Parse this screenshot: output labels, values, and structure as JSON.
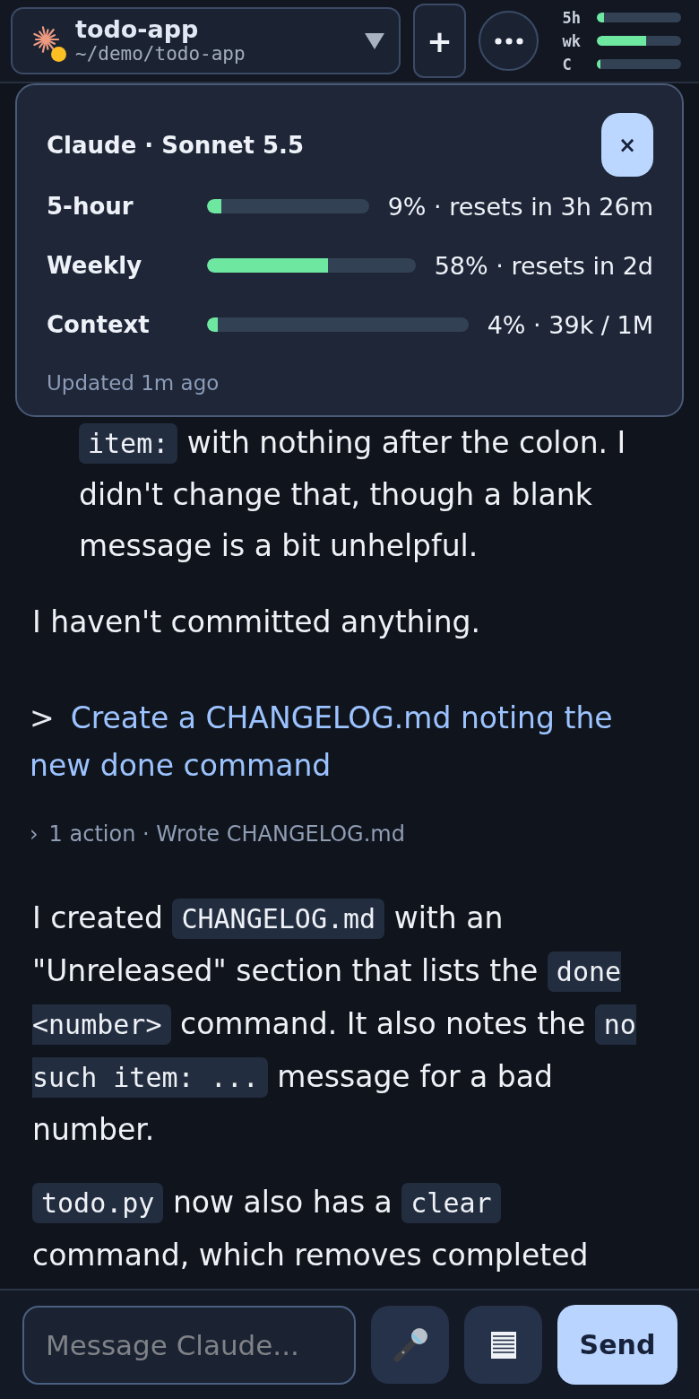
{
  "header": {
    "project": {
      "name": "todo-app",
      "path": "~/demo/todo-app"
    },
    "new_button": "+",
    "usage": [
      {
        "label": "5h",
        "level": 0.09
      },
      {
        "label": "wk",
        "level": 0.58
      },
      {
        "label": "C",
        "level": 0.04
      }
    ]
  },
  "usage_popup": {
    "title": "Claude · Sonnet 5.5",
    "close": "×",
    "rows": [
      {
        "label": "5-hour",
        "level": 0.09,
        "reading": "9% · resets in 3h 26m"
      },
      {
        "label": "Weekly",
        "level": 0.58,
        "reading": "58% · resets in 2d"
      },
      {
        "label": "Context",
        "level": 0.04,
        "reading": "4% · 39k / 1M"
      }
    ],
    "updated": "Updated 1m ago"
  },
  "chat": [
    {
      "kind": "list_item",
      "segments": [
        {
          "kind": "code",
          "text": "item:"
        },
        {
          "kind": "text",
          "text": " with nothing after the colon. I didn't change that, though a blank message is a bit unhelpful."
        }
      ]
    },
    {
      "kind": "paragraph",
      "segments": [
        {
          "kind": "text",
          "text": "I haven't committed anything."
        }
      ]
    },
    {
      "kind": "prompt",
      "marker": ">",
      "text": "Create a CHANGELOG.md noting the new done command"
    },
    {
      "kind": "actions",
      "chevron": "›",
      "text": "1 action · Wrote CHANGELOG.md"
    },
    {
      "kind": "paragraph",
      "segments": [
        {
          "kind": "text",
          "text": "I created "
        },
        {
          "kind": "code",
          "text": "CHANGELOG.md"
        },
        {
          "kind": "text",
          "text": " with an \"Unreleased\" section that lists the "
        },
        {
          "kind": "code",
          "text": "done <number>"
        },
        {
          "kind": "text",
          "text": " command. It also notes the "
        },
        {
          "kind": "code",
          "text": "no such item: ..."
        },
        {
          "kind": "text",
          "text": " message for a bad number."
        }
      ]
    },
    {
      "kind": "paragraph",
      "segments": [
        {
          "kind": "code",
          "text": "todo.py"
        },
        {
          "kind": "text",
          "text": " now also has a "
        },
        {
          "kind": "code",
          "text": "clear"
        },
        {
          "kind": "text",
          "text": " command, which removes completed"
        }
      ]
    }
  ],
  "composer": {
    "placeholder": "Message Claude...",
    "send": "Send"
  }
}
